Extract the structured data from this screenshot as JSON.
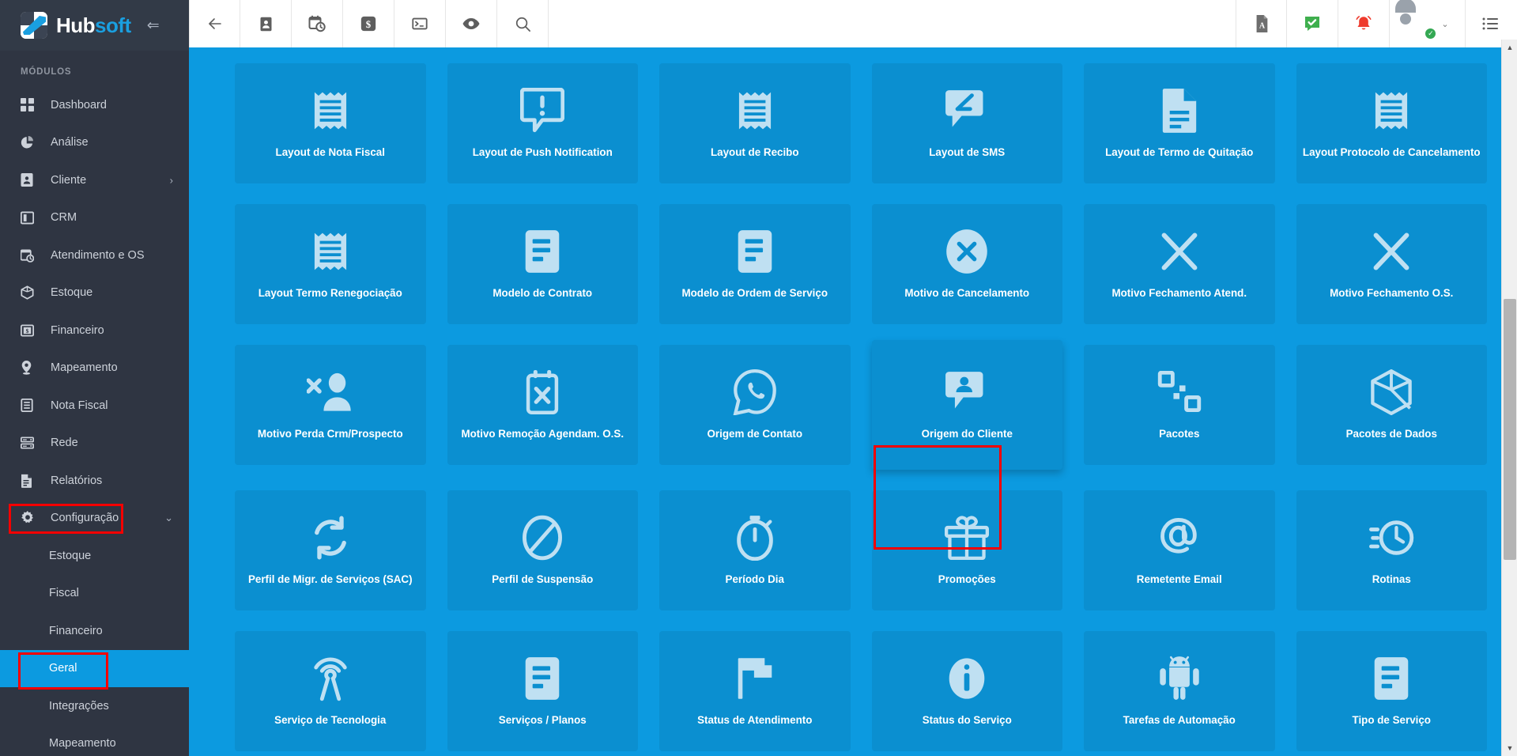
{
  "brand": {
    "name_primary": "Hub",
    "name_secondary": "soft",
    "collapse_icon": "⇐",
    "logo_icon": "hubsoft-logo"
  },
  "sidebar": {
    "section_title": "MÓDULOS",
    "items": [
      {
        "label": "Dashboard",
        "icon": "dashboard-icon",
        "active": false,
        "has_chevron": false,
        "sub": false
      },
      {
        "label": "Análise",
        "icon": "chart-pie-icon",
        "active": false,
        "has_chevron": false,
        "sub": false
      },
      {
        "label": "Cliente",
        "icon": "user-card-icon",
        "active": false,
        "has_chevron": true,
        "sub": false
      },
      {
        "label": "CRM",
        "icon": "crm-board-icon",
        "active": false,
        "has_chevron": false,
        "sub": false
      },
      {
        "label": "Atendimento e OS",
        "icon": "calendar-clock-icon",
        "active": false,
        "has_chevron": false,
        "sub": false
      },
      {
        "label": "Estoque",
        "icon": "box-icon",
        "active": false,
        "has_chevron": false,
        "sub": false
      },
      {
        "label": "Financeiro",
        "icon": "money-icon",
        "active": false,
        "has_chevron": false,
        "sub": false
      },
      {
        "label": "Mapeamento",
        "icon": "map-pin-icon",
        "active": false,
        "has_chevron": false,
        "sub": false
      },
      {
        "label": "Nota Fiscal",
        "icon": "invoice-icon",
        "active": false,
        "has_chevron": false,
        "sub": false
      },
      {
        "label": "Rede",
        "icon": "server-icon",
        "active": false,
        "has_chevron": false,
        "sub": false
      },
      {
        "label": "Relatórios",
        "icon": "report-icon",
        "active": false,
        "has_chevron": false,
        "sub": false
      },
      {
        "label": "Configuração",
        "icon": "gear-icon",
        "active": false,
        "has_chevron": true,
        "sub": false
      },
      {
        "label": "Estoque",
        "icon": "",
        "active": false,
        "has_chevron": false,
        "sub": true
      },
      {
        "label": "Fiscal",
        "icon": "",
        "active": false,
        "has_chevron": false,
        "sub": true
      },
      {
        "label": "Financeiro",
        "icon": "",
        "active": false,
        "has_chevron": false,
        "sub": true
      },
      {
        "label": "Geral",
        "icon": "",
        "active": true,
        "has_chevron": false,
        "sub": true
      },
      {
        "label": "Integrações",
        "icon": "",
        "active": false,
        "has_chevron": false,
        "sub": true
      },
      {
        "label": "Mapeamento",
        "icon": "",
        "active": false,
        "has_chevron": false,
        "sub": true
      }
    ],
    "chevron_right": "›",
    "chevron_down": "⌄"
  },
  "toolbar": {
    "left_buttons": [
      {
        "name": "back-arrow-icon",
        "glyph": "←"
      },
      {
        "name": "user-card-icon",
        "glyph": ""
      },
      {
        "name": "calendar-clock-icon",
        "glyph": ""
      },
      {
        "name": "money-dollar-icon",
        "glyph": ""
      },
      {
        "name": "terminal-icon",
        "glyph": ""
      },
      {
        "name": "eye-icon",
        "glyph": ""
      },
      {
        "name": "search-icon",
        "glyph": ""
      }
    ],
    "right_buttons": [
      {
        "name": "pdf-icon"
      },
      {
        "name": "chat-check-icon"
      },
      {
        "name": "bell-alert-icon"
      }
    ],
    "user": {
      "caret": "⌄",
      "status": "online"
    },
    "menu_icon": "list-menu-icon"
  },
  "main": {
    "tiles": [
      {
        "label": "Layout de Nota Fiscal",
        "icon": "receipt-icon",
        "highlighted": false,
        "hover": false
      },
      {
        "label": "Layout de Push Notification",
        "icon": "push-alert-icon",
        "highlighted": false,
        "hover": false
      },
      {
        "label": "Layout de Recibo",
        "icon": "receipt-icon",
        "highlighted": false,
        "hover": false
      },
      {
        "label": "Layout de SMS",
        "icon": "sms-edit-icon",
        "highlighted": false,
        "hover": false
      },
      {
        "label": "Layout de Termo de Quitação",
        "icon": "document-icon",
        "highlighted": false,
        "hover": false
      },
      {
        "label": "Layout Protocolo de Cancelamento",
        "icon": "receipt-icon",
        "highlighted": false,
        "hover": false
      },
      {
        "label": "Layout Termo Renegociação",
        "icon": "receipt-icon",
        "highlighted": false,
        "hover": false
      },
      {
        "label": "Modelo de Contrato",
        "icon": "file-lines-icon",
        "highlighted": false,
        "hover": false
      },
      {
        "label": "Modelo de Ordem de Serviço",
        "icon": "file-lines-icon",
        "highlighted": false,
        "hover": false
      },
      {
        "label": "Motivo de Cancelamento",
        "icon": "x-circle-icon",
        "highlighted": false,
        "hover": false
      },
      {
        "label": "Motivo Fechamento Atend.",
        "icon": "x-icon",
        "highlighted": false,
        "hover": false
      },
      {
        "label": "Motivo Fechamento O.S.",
        "icon": "x-icon",
        "highlighted": false,
        "hover": false
      },
      {
        "label": "Motivo Perda Crm/Prospecto",
        "icon": "user-remove-icon",
        "highlighted": false,
        "hover": false
      },
      {
        "label": "Motivo Remoção Agendam. O.S.",
        "icon": "calendar-x-icon",
        "highlighted": false,
        "hover": false
      },
      {
        "label": "Origem de Contato",
        "icon": "whatsapp-icon",
        "highlighted": false,
        "hover": false
      },
      {
        "label": "Origem do Cliente",
        "icon": "user-chat-icon",
        "highlighted": false,
        "hover": true
      },
      {
        "label": "Pacotes",
        "icon": "squares-icon",
        "highlighted": false,
        "hover": false
      },
      {
        "label": "Pacotes de Dados",
        "icon": "cube-icon",
        "highlighted": false,
        "hover": false
      },
      {
        "label": "Perfil de Migr. de Serviços (SAC)",
        "icon": "sync-icon",
        "highlighted": false,
        "hover": false
      },
      {
        "label": "Perfil de Suspensão",
        "icon": "ban-icon",
        "highlighted": false,
        "hover": false
      },
      {
        "label": "Período Dia",
        "icon": "stopwatch-icon",
        "highlighted": false,
        "hover": false
      },
      {
        "label": "Promoções",
        "icon": "gift-icon",
        "highlighted": false,
        "hover": false
      },
      {
        "label": "Remetente Email",
        "icon": "at-email-icon",
        "highlighted": true,
        "hover": false
      },
      {
        "label": "Rotinas",
        "icon": "clock-speed-icon",
        "highlighted": false,
        "hover": false
      },
      {
        "label": "Serviço de Tecnologia",
        "icon": "broadcast-icon",
        "highlighted": false,
        "hover": false
      },
      {
        "label": "Serviços / Planos",
        "icon": "file-lines-icon",
        "highlighted": false,
        "hover": false
      },
      {
        "label": "Status de Atendimento",
        "icon": "flag-icon",
        "highlighted": false,
        "hover": false
      },
      {
        "label": "Status do Serviço",
        "icon": "info-circle-icon",
        "highlighted": false,
        "hover": false
      },
      {
        "label": "Tarefas de Automação",
        "icon": "android-icon",
        "highlighted": false,
        "hover": false
      },
      {
        "label": "Tipo de Serviço",
        "icon": "file-lines-icon",
        "highlighted": false,
        "hover": false
      }
    ]
  },
  "scrollbar": {
    "up_arrow": "▲",
    "down_arrow": "▼"
  },
  "colors": {
    "sidebar_bg": "#2f3542",
    "accent_blue": "#0c9ae0",
    "tile_bg": "#0b8fd0",
    "tile_icon": "#bfe0f2",
    "highlight_red": "#f50000",
    "brand_blue": "#1a9fe0"
  }
}
